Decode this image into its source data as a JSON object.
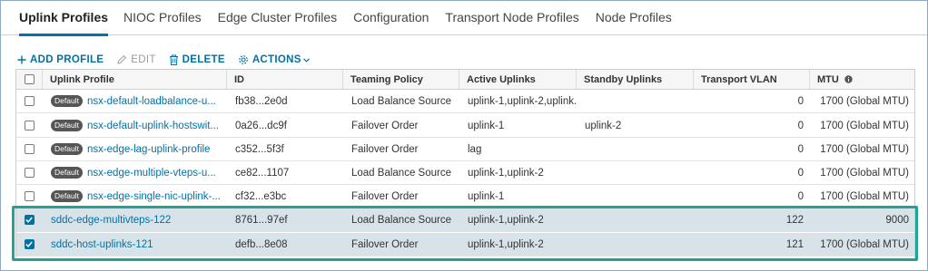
{
  "tabs": [
    {
      "label": "Uplink Profiles",
      "active": true
    },
    {
      "label": "NIOC Profiles"
    },
    {
      "label": "Edge Cluster Profiles"
    },
    {
      "label": "Configuration"
    },
    {
      "label": "Transport Node Profiles"
    },
    {
      "label": "Node Profiles"
    }
  ],
  "toolbar": {
    "add": "ADD PROFILE",
    "edit": "EDIT",
    "delete": "DELETE",
    "actions": "ACTIONS"
  },
  "table": {
    "columns": [
      "Uplink Profile",
      "ID",
      "Teaming Policy",
      "Active Uplinks",
      "Standby Uplinks",
      "Transport VLAN",
      "MTU"
    ],
    "rows": [
      {
        "badge": "Default",
        "name": "nsx-default-loadbalance-u...",
        "id": "fb38...2e0d",
        "teaming": "Load Balance Source",
        "active": "uplink-1,uplink-2,uplink...",
        "standby": "",
        "vlan": "0",
        "mtu": "1700 (Global MTU)",
        "checked": false
      },
      {
        "badge": "Default",
        "name": "nsx-default-uplink-hostswit...",
        "id": "0a26...dc9f",
        "teaming": "Failover Order",
        "active": "uplink-1",
        "standby": "uplink-2",
        "vlan": "0",
        "mtu": "1700 (Global MTU)",
        "checked": false
      },
      {
        "badge": "Default",
        "name": "nsx-edge-lag-uplink-profile",
        "id": "c352...5f3f",
        "teaming": "Failover Order",
        "active": "lag",
        "standby": "",
        "vlan": "0",
        "mtu": "1700 (Global MTU)",
        "checked": false
      },
      {
        "badge": "Default",
        "name": "nsx-edge-multiple-vteps-u...",
        "id": "ce82...1107",
        "teaming": "Load Balance Source",
        "active": "uplink-1,uplink-2",
        "standby": "",
        "vlan": "0",
        "mtu": "1700 (Global MTU)",
        "checked": false
      },
      {
        "badge": "Default",
        "name": "nsx-edge-single-nic-uplink-...",
        "id": "cf32...e3bc",
        "teaming": "Failover Order",
        "active": "uplink-1",
        "standby": "",
        "vlan": "0",
        "mtu": "1700 (Global MTU)",
        "checked": false
      },
      {
        "badge": "",
        "name": "sddc-edge-multivteps-122",
        "id": "8761...97ef",
        "teaming": "Load Balance Source",
        "active": "uplink-1,uplink-2",
        "standby": "",
        "vlan": "122",
        "mtu": "9000",
        "checked": true
      },
      {
        "badge": "",
        "name": "sddc-host-uplinks-121",
        "id": "defb...8e08",
        "teaming": "Failover Order",
        "active": "uplink-1,uplink-2",
        "standby": "",
        "vlan": "121",
        "mtu": "1700 (Global MTU)",
        "checked": true
      }
    ]
  },
  "icons": {
    "add": "plus-icon",
    "edit": "pencil-icon",
    "delete": "trash-icon",
    "actions": "gear-icon",
    "mtu_info": "info-icon"
  },
  "colors": {
    "accent": "#0072a3",
    "selected_row": "#d8e3e9",
    "highlight": "#21a391",
    "badge": "#565656"
  }
}
